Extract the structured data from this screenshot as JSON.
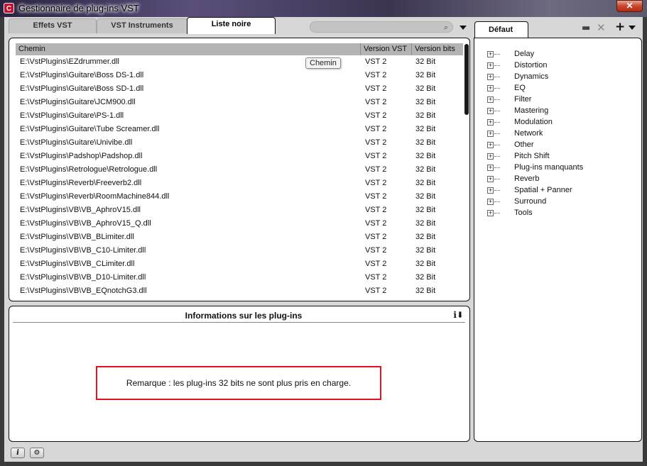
{
  "window": {
    "title": "Gestionnaire de plug-ins VST",
    "close_label": "✕"
  },
  "tabs": [
    {
      "label": "Effets VST"
    },
    {
      "label": "VST Instruments"
    },
    {
      "label": "Liste noire"
    }
  ],
  "list": {
    "columns": [
      "Chemin",
      "Version VST",
      "Version bits"
    ],
    "tooltip": "Chemin",
    "rows": [
      [
        "E:\\VstPlugins\\EZdrummer.dll",
        "VST 2",
        "32 Bit"
      ],
      [
        "E:\\VstPlugins\\Guitare\\Boss DS-1.dll",
        "VST 2",
        "32 Bit"
      ],
      [
        "E:\\VstPlugins\\Guitare\\Boss SD-1.dll",
        "VST 2",
        "32 Bit"
      ],
      [
        "E:\\VstPlugins\\Guitare\\JCM900.dll",
        "VST 2",
        "32 Bit"
      ],
      [
        "E:\\VstPlugins\\Guitare\\PS-1.dll",
        "VST 2",
        "32 Bit"
      ],
      [
        "E:\\VstPlugins\\Guitare\\Tube Screamer.dll",
        "VST 2",
        "32 Bit"
      ],
      [
        "E:\\VstPlugins\\Guitare\\Univibe.dll",
        "VST 2",
        "32 Bit"
      ],
      [
        "E:\\VstPlugins\\Padshop\\Padshop.dll",
        "VST 2",
        "32 Bit"
      ],
      [
        "E:\\VstPlugins\\Retrologue\\Retrologue.dll",
        "VST 2",
        "32 Bit"
      ],
      [
        "E:\\VstPlugins\\Reverb\\Freeverb2.dll",
        "VST 2",
        "32 Bit"
      ],
      [
        "E:\\VstPlugins\\Reverb\\RoomMachine844.dll",
        "VST 2",
        "32 Bit"
      ],
      [
        "E:\\VstPlugins\\VB\\VB_AphroV15.dll",
        "VST 2",
        "32 Bit"
      ],
      [
        "E:\\VstPlugins\\VB\\VB_AphroV15_Q.dll",
        "VST 2",
        "32 Bit"
      ],
      [
        "E:\\VstPlugins\\VB\\VB_BLimiter.dll",
        "VST 2",
        "32 Bit"
      ],
      [
        "E:\\VstPlugins\\VB\\VB_C10-Limiter.dll",
        "VST 2",
        "32 Bit"
      ],
      [
        "E:\\VstPlugins\\VB\\VB_CLimiter.dll",
        "VST 2",
        "32 Bit"
      ],
      [
        "E:\\VstPlugins\\VB\\VB_D10-Limiter.dll",
        "VST 2",
        "32 Bit"
      ],
      [
        "E:\\VstPlugins\\VB\\VB_EQnotchG3.dll",
        "VST 2",
        "32 Bit"
      ]
    ]
  },
  "info": {
    "title": "Informations sur les plug-ins",
    "note": "Remarque : les plug-ins 32 bits ne sont plus pris en charge.",
    "note_border_color": "#e0141e"
  },
  "right": {
    "tab_label": "Défaut",
    "categories": [
      "Delay",
      "Distortion",
      "Dynamics",
      "EQ",
      "Filter",
      "Mastering",
      "Modulation",
      "Network",
      "Other",
      "Pitch Shift",
      "Plug-ins manquants",
      "Reverb",
      "Spatial + Panner",
      "Surround",
      "Tools"
    ]
  },
  "icons": {
    "search": "search-icon",
    "folder": "folder-icon",
    "remove": "close-icon",
    "add": "plus-icon",
    "info": "info-icon",
    "settings": "gear-icon"
  }
}
